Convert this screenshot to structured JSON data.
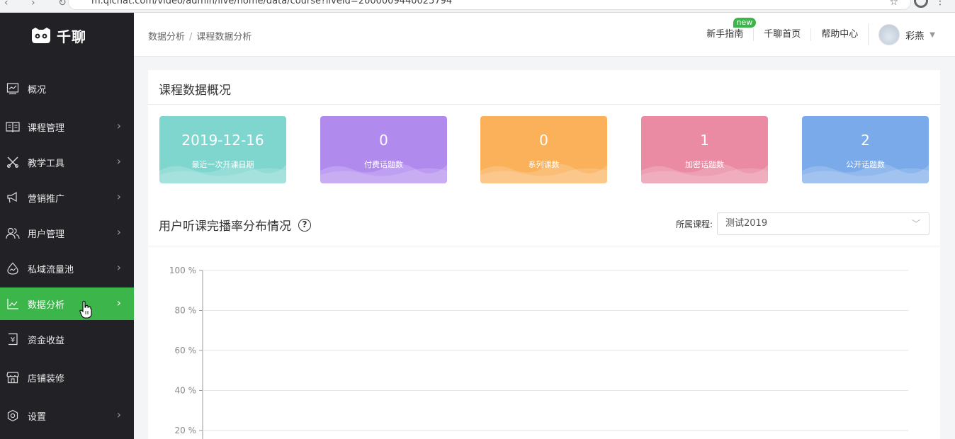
{
  "browser": {
    "url": "m.qlchat.com/video/admin/live/home/data/course?liveId=2000009440025794"
  },
  "brand": {
    "name": "千聊"
  },
  "sidebar": {
    "items": [
      {
        "label": "概况",
        "icon": "overview-icon",
        "has_arrow": false,
        "active": false
      },
      {
        "label": "课程管理",
        "icon": "course-management-icon",
        "has_arrow": true,
        "active": false
      },
      {
        "label": "教学工具",
        "icon": "teaching-tools-icon",
        "has_arrow": true,
        "active": false
      },
      {
        "label": "营销推广",
        "icon": "marketing-icon",
        "has_arrow": true,
        "active": false
      },
      {
        "label": "用户管理",
        "icon": "user-management-icon",
        "has_arrow": true,
        "active": false
      },
      {
        "label": "私域流量池",
        "icon": "traffic-pool-icon",
        "has_arrow": true,
        "active": false
      },
      {
        "label": "数据分析",
        "icon": "data-analysis-icon",
        "has_arrow": true,
        "active": true
      },
      {
        "label": "资金收益",
        "icon": "revenue-icon",
        "has_arrow": false,
        "active": false
      },
      {
        "label": "店铺装修",
        "icon": "store-decoration-icon",
        "has_arrow": false,
        "active": false
      },
      {
        "label": "设置",
        "icon": "settings-icon",
        "has_arrow": true,
        "active": false
      }
    ],
    "active_color": "#3cb54a"
  },
  "header": {
    "breadcrumb": [
      "数据分析",
      "课程数据分析"
    ],
    "links": [
      {
        "label": "新手指南",
        "badge": "new"
      },
      {
        "label": "千聊首页"
      },
      {
        "label": "帮助中心"
      }
    ],
    "user": {
      "name": "彩燕"
    }
  },
  "overview": {
    "title": "课程数据概况",
    "cards": [
      {
        "value": "2019-12-16",
        "label": "最近一次开课日期",
        "color": "#7fd6cf"
      },
      {
        "value": "0",
        "label": "付费话题数",
        "color": "#b18aee"
      },
      {
        "value": "0",
        "label": "系列课数",
        "color": "#fbb05a"
      },
      {
        "value": "1",
        "label": "加密话题数",
        "color": "#ea8aa3"
      },
      {
        "value": "2",
        "label": "公开话题数",
        "color": "#7aaae9"
      }
    ]
  },
  "distribution": {
    "title": "用户听课完播率分布情况",
    "filter_label": "所属课程:",
    "selected_course": "测试2019"
  },
  "chart_data": {
    "type": "bar",
    "y_ticks": [
      "100 %",
      "80 %",
      "60 %",
      "40 %",
      "20 %"
    ],
    "ylim": [
      0,
      100
    ],
    "grid": true,
    "series": []
  }
}
